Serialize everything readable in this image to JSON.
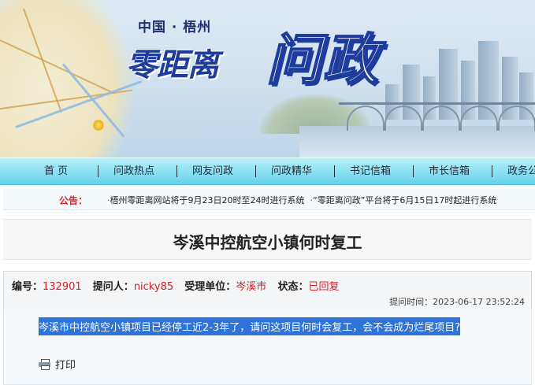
{
  "banner": {
    "subtitle": "中国 · 梧州",
    "title_small": "零距离",
    "title_big": "问政"
  },
  "nav": {
    "items": [
      {
        "label": "首  页"
      },
      {
        "label": "问政热点"
      },
      {
        "label": "网友问政"
      },
      {
        "label": "问政精华"
      },
      {
        "label": "书记信箱"
      },
      {
        "label": "市长信箱"
      },
      {
        "label": "政务公"
      }
    ]
  },
  "notice": {
    "label": "公告：",
    "items": [
      "梧州零距离网站将于9月23日20时至24时进行系统",
      "“零距离问政”平台将于6月15日17时起进行系统"
    ]
  },
  "question": {
    "title": "岑溪中控航空小镇何时复工",
    "id_label": "编号：",
    "id": "132901",
    "asker_label": "提问人：",
    "asker": "nicky85",
    "dept_label": "受理单位：",
    "dept": "岑溪市",
    "status_label": "状态：",
    "status": "已回复",
    "time_label": "提问时间：",
    "time": "2023-06-17 23:52:24",
    "body": "岑溪市中控航空小镇项目已经停工近2-3年了，请问这项目何时会复工，会不会成为烂尾项目?"
  },
  "actions": {
    "print_label": "打印"
  },
  "colors": {
    "accent_blue": "#1f3c9c",
    "nav_top": "#b8f0f8",
    "nav_bottom": "#64d2ec",
    "red": "#d6202a",
    "selection": "#2f72d8"
  },
  "icons": {
    "print": "printer-icon",
    "map": "map-illustration"
  }
}
